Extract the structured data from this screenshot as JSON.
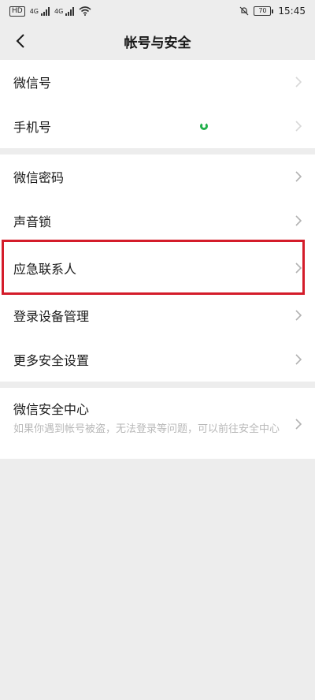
{
  "status_bar": {
    "left_chip": "HD",
    "net1": "4G",
    "net2": "4G",
    "battery": "70",
    "time": "15:45"
  },
  "nav": {
    "title": "帐号与安全"
  },
  "account_group": [
    {
      "label": "微信号"
    },
    {
      "label": "手机号"
    }
  ],
  "security_group": [
    {
      "label": "微信密码"
    },
    {
      "label": "声音锁"
    },
    {
      "label": "应急联系人"
    },
    {
      "label": "登录设备管理"
    },
    {
      "label": "更多安全设置"
    }
  ],
  "security_center": {
    "title": "微信安全中心",
    "description": "如果你遇到帐号被盗，无法登录等问题，可以前往安全中心"
  },
  "colors": {
    "background": "#ededed",
    "card": "#ffffff",
    "highlight": "#d41c2a",
    "accent_green": "#21b04b"
  }
}
